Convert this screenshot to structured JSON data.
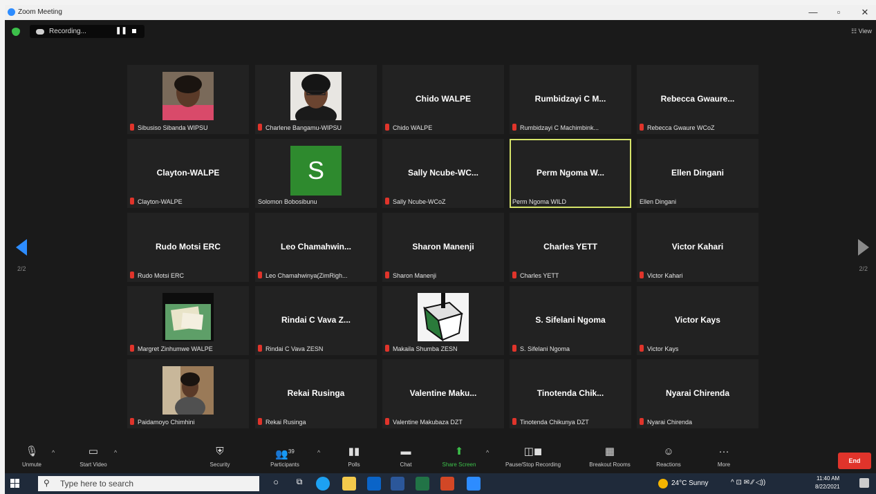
{
  "window": {
    "title": "Zoom Meeting",
    "controls": [
      "—",
      "▫",
      "✕"
    ]
  },
  "recording": {
    "label": "Recording...",
    "pause_icon": "pause-icon",
    "stop_icon": "stop-icon"
  },
  "view_button": "☷ View",
  "pagination": {
    "left": "2/2",
    "right": "2/2"
  },
  "tiles": [
    {
      "big": "",
      "label": "Sibusiso Sibanda WIPSU",
      "muted": true,
      "photo": "woman-smiling"
    },
    {
      "big": "",
      "label": "Charlene Bangamu-WIPSU",
      "muted": true,
      "photo": "woman-glasses"
    },
    {
      "big": "Chido WALPE",
      "label": "Chido WALPE",
      "muted": true
    },
    {
      "big": "Rumbidzayi C M...",
      "label": "Rumbidzayi C Machimbink...",
      "muted": true
    },
    {
      "big": "Rebecca Gwaure...",
      "label": "Rebecca Gwaure WCoZ",
      "muted": true
    },
    {
      "big": "Clayton-WALPE",
      "label": "Clayton-WALPE",
      "muted": true
    },
    {
      "big": "",
      "label": "Solomon Bobosibunu",
      "muted": false,
      "avatar": "S"
    },
    {
      "big": "Sally Ncube-WC...",
      "label": "Sally Ncube-WCoZ",
      "muted": true
    },
    {
      "big": "Perm Ngoma W...",
      "label": "Perm Ngoma WILD",
      "muted": false,
      "active": true
    },
    {
      "big": "Ellen Dingani",
      "label": "Ellen Dingani",
      "muted": false
    },
    {
      "big": "Rudo Motsi ERC",
      "label": "Rudo Motsi ERC",
      "muted": true
    },
    {
      "big": "Leo Chamahwin...",
      "label": "Leo Chamahwinya(ZimRigh...",
      "muted": true
    },
    {
      "big": "Sharon Manenji",
      "label": "Sharon Manenji",
      "muted": true
    },
    {
      "big": "Charles YETT",
      "label": "Charles YETT",
      "muted": true
    },
    {
      "big": "Victor Kahari",
      "label": "Victor Kahari",
      "muted": true
    },
    {
      "big": "",
      "label": "Margret Zinhumwe WALPE",
      "muted": true,
      "photo": "document-poster"
    },
    {
      "big": "Rindai C Vava Z...",
      "label": "Rindai C Vava ZESN",
      "muted": true
    },
    {
      "big": "",
      "label": "Makaila Shumba ZESN",
      "muted": true,
      "photo": "ballot-box-logo"
    },
    {
      "big": "S. Sifelani Ngoma",
      "label": "S. Sifelani Ngoma",
      "muted": true
    },
    {
      "big": "Victor Kays",
      "label": "Victor Kays",
      "muted": true
    },
    {
      "big": "",
      "label": "Paidamoyo Chimhini",
      "muted": true,
      "photo": "woman-at-desk"
    },
    {
      "big": "Rekai Rusinga",
      "label": "Rekai Rusinga",
      "muted": true
    },
    {
      "big": "Valentine Maku...",
      "label": "Valentine Makubaza DZT",
      "muted": true
    },
    {
      "big": "Tinotenda Chik...",
      "label": "Tinotenda Chikunya DZT",
      "muted": true
    },
    {
      "big": "Nyarai Chirenda",
      "label": "Nyarai Chirenda",
      "muted": true
    }
  ],
  "toolbar": {
    "unmute": "Unmute",
    "start_video": "Start Video",
    "security": "Security",
    "participants": "Participants",
    "participants_count": "39",
    "polls": "Polls",
    "chat": "Chat",
    "share_screen": "Share Screen",
    "pause_recording": "Pause/Stop Recording",
    "breakout": "Breakout Rooms",
    "reactions": "Reactions",
    "more": "More",
    "end": "End",
    "more_glyph": "···"
  },
  "taskbar": {
    "search_placeholder": "Type here to search",
    "weather": "24°C  Sunny",
    "time": "11:40 AM",
    "date": "8/22/2021",
    "tray_glyphs": "^  ⊡  ✉  ∕∕  ◁))"
  },
  "colors": {
    "accent": "#2d8cff",
    "end_red": "#e0342b",
    "active_speaker": "#d6e46a",
    "share_green": "#3cc04a"
  }
}
